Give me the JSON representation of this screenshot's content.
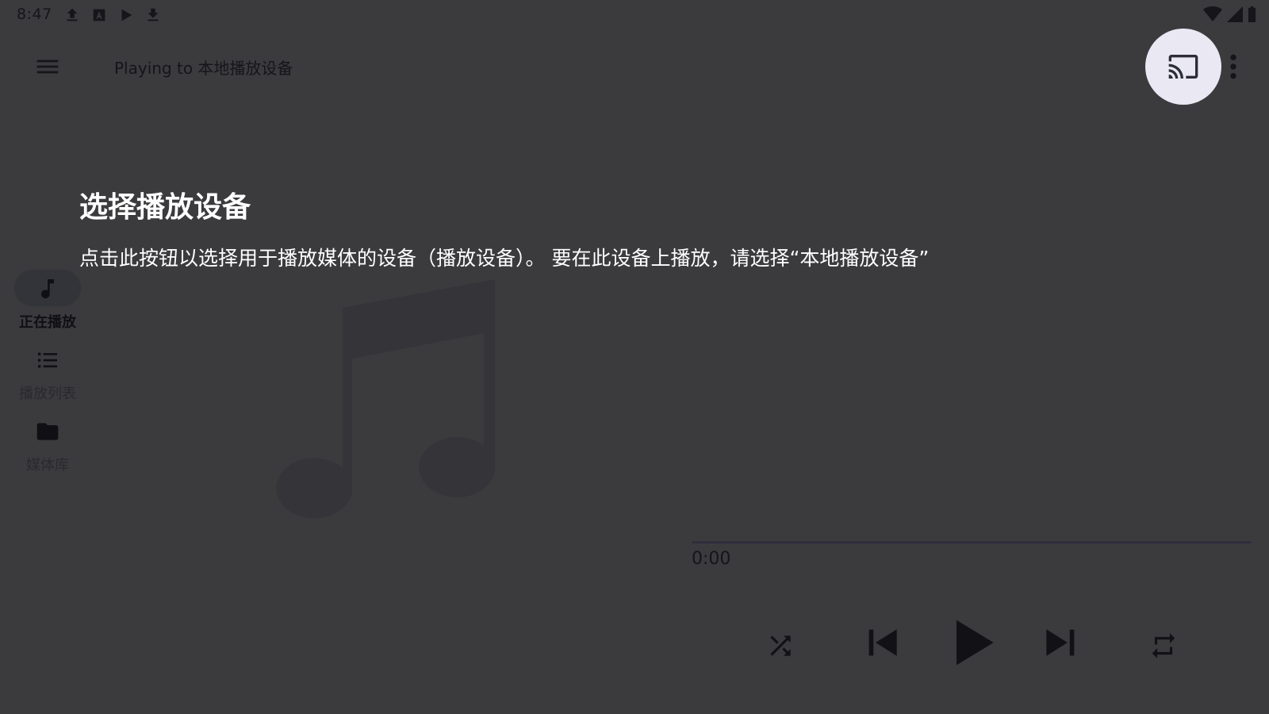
{
  "status_bar": {
    "time": "8:47",
    "left_icons": [
      "upload-icon",
      "a-badge-icon",
      "play-store-icon",
      "download-icon"
    ],
    "right_icons": [
      "wifi-icon",
      "signal-icon",
      "battery-icon"
    ]
  },
  "toolbar": {
    "title": "Playing to 本地播放设备",
    "menu_icon": "hamburger-menu-icon",
    "cast_icon": "cast-icon",
    "overflow_icon": "more-vert-icon"
  },
  "nav_rail": {
    "items": [
      {
        "label": "正在播放",
        "icon": "music-note-icon",
        "active": true
      },
      {
        "label": "播放列表",
        "icon": "list-icon",
        "active": false
      },
      {
        "label": "媒体库",
        "icon": "folder-icon",
        "active": false
      }
    ]
  },
  "player": {
    "album_art_icon": "music-note-placeholder-icon",
    "elapsed": "0:00",
    "progress": 0,
    "controls": [
      "shuffle-icon",
      "skip-previous-icon",
      "play-icon",
      "skip-next-icon",
      "repeat-icon"
    ]
  },
  "showcase": {
    "title": "选择播放设备",
    "description": "点击此按钮以选择用于播放媒体的设备（播放设备）。 要在此设备上播放，请选择“本地播放设备”"
  },
  "colors": {
    "scrim": "#3b3b3e",
    "spotlight": "#e9e8f3",
    "text_on_scrim": "#ffffff"
  }
}
